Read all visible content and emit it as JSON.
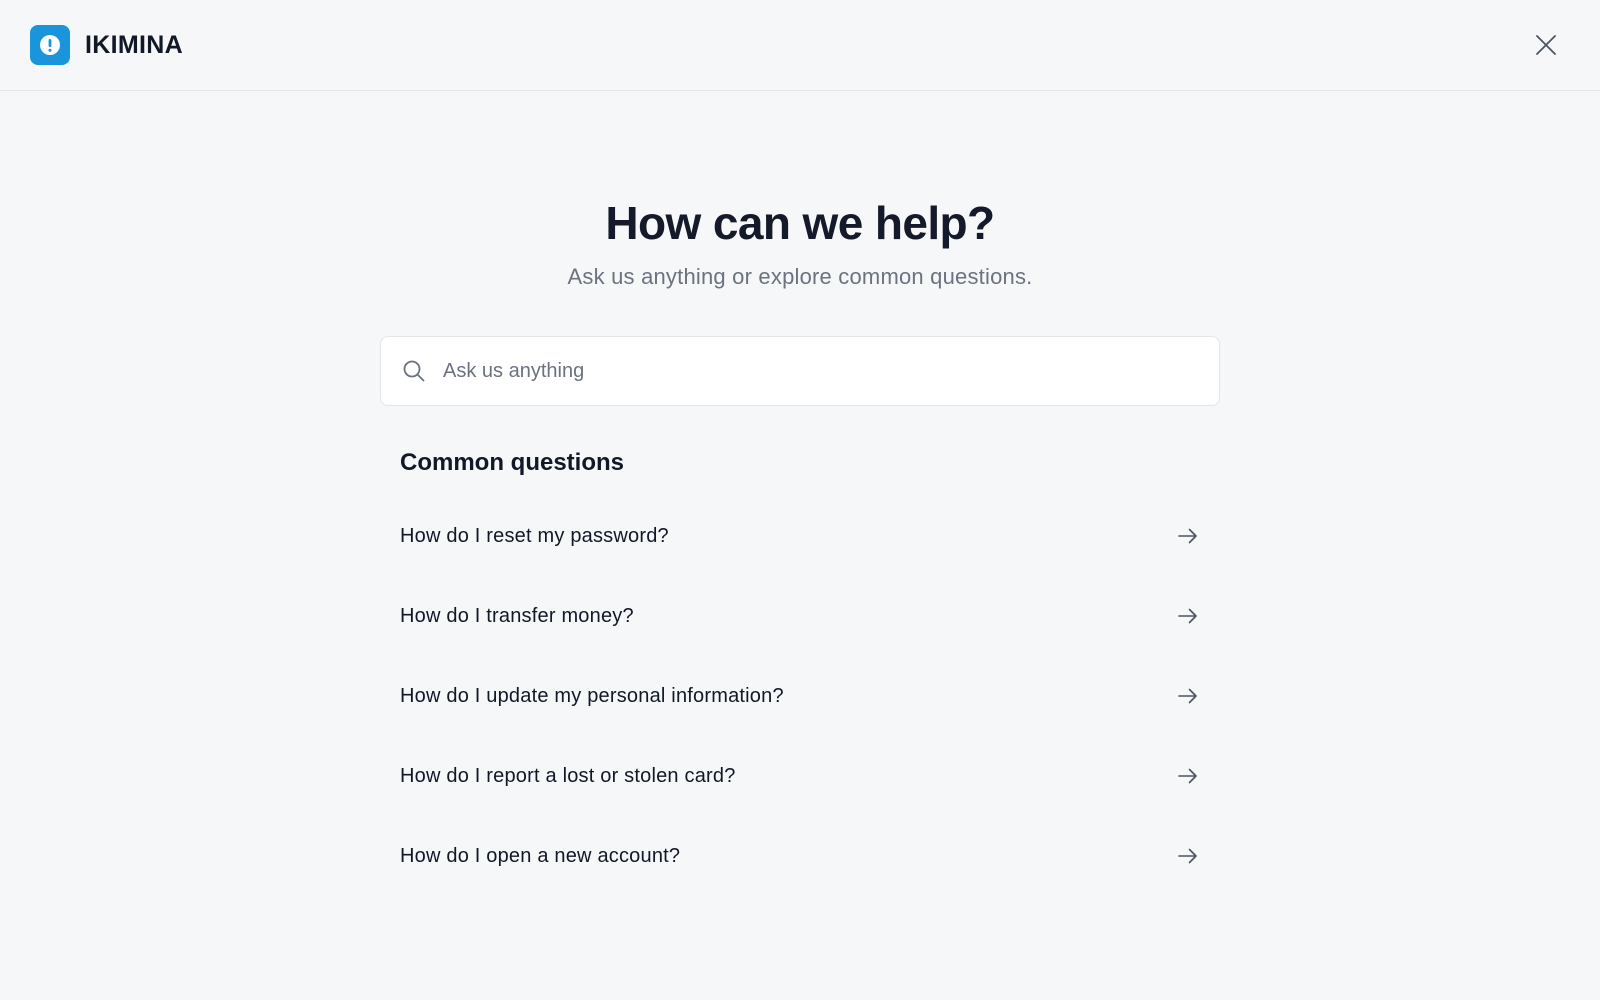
{
  "header": {
    "brand_name": "IKIMINA",
    "logo_icon": "alert-circle-icon",
    "logo_color": "#1a95dc",
    "close_icon": "close-icon"
  },
  "hero": {
    "title": "How can we help?",
    "subtitle": "Ask us anything or explore common questions."
  },
  "search": {
    "placeholder": "Ask us anything",
    "value": "",
    "icon": "search-icon"
  },
  "common_questions": {
    "title": "Common questions",
    "items": [
      {
        "label": "How do I reset my password?",
        "icon": "arrow-right-icon"
      },
      {
        "label": "How do I transfer money?",
        "icon": "arrow-right-icon"
      },
      {
        "label": "How do I update my personal information?",
        "icon": "arrow-right-icon"
      },
      {
        "label": "How do I report a lost or stolen card?",
        "icon": "arrow-right-icon"
      },
      {
        "label": "How do I open a new account?",
        "icon": "arrow-right-icon"
      }
    ]
  }
}
